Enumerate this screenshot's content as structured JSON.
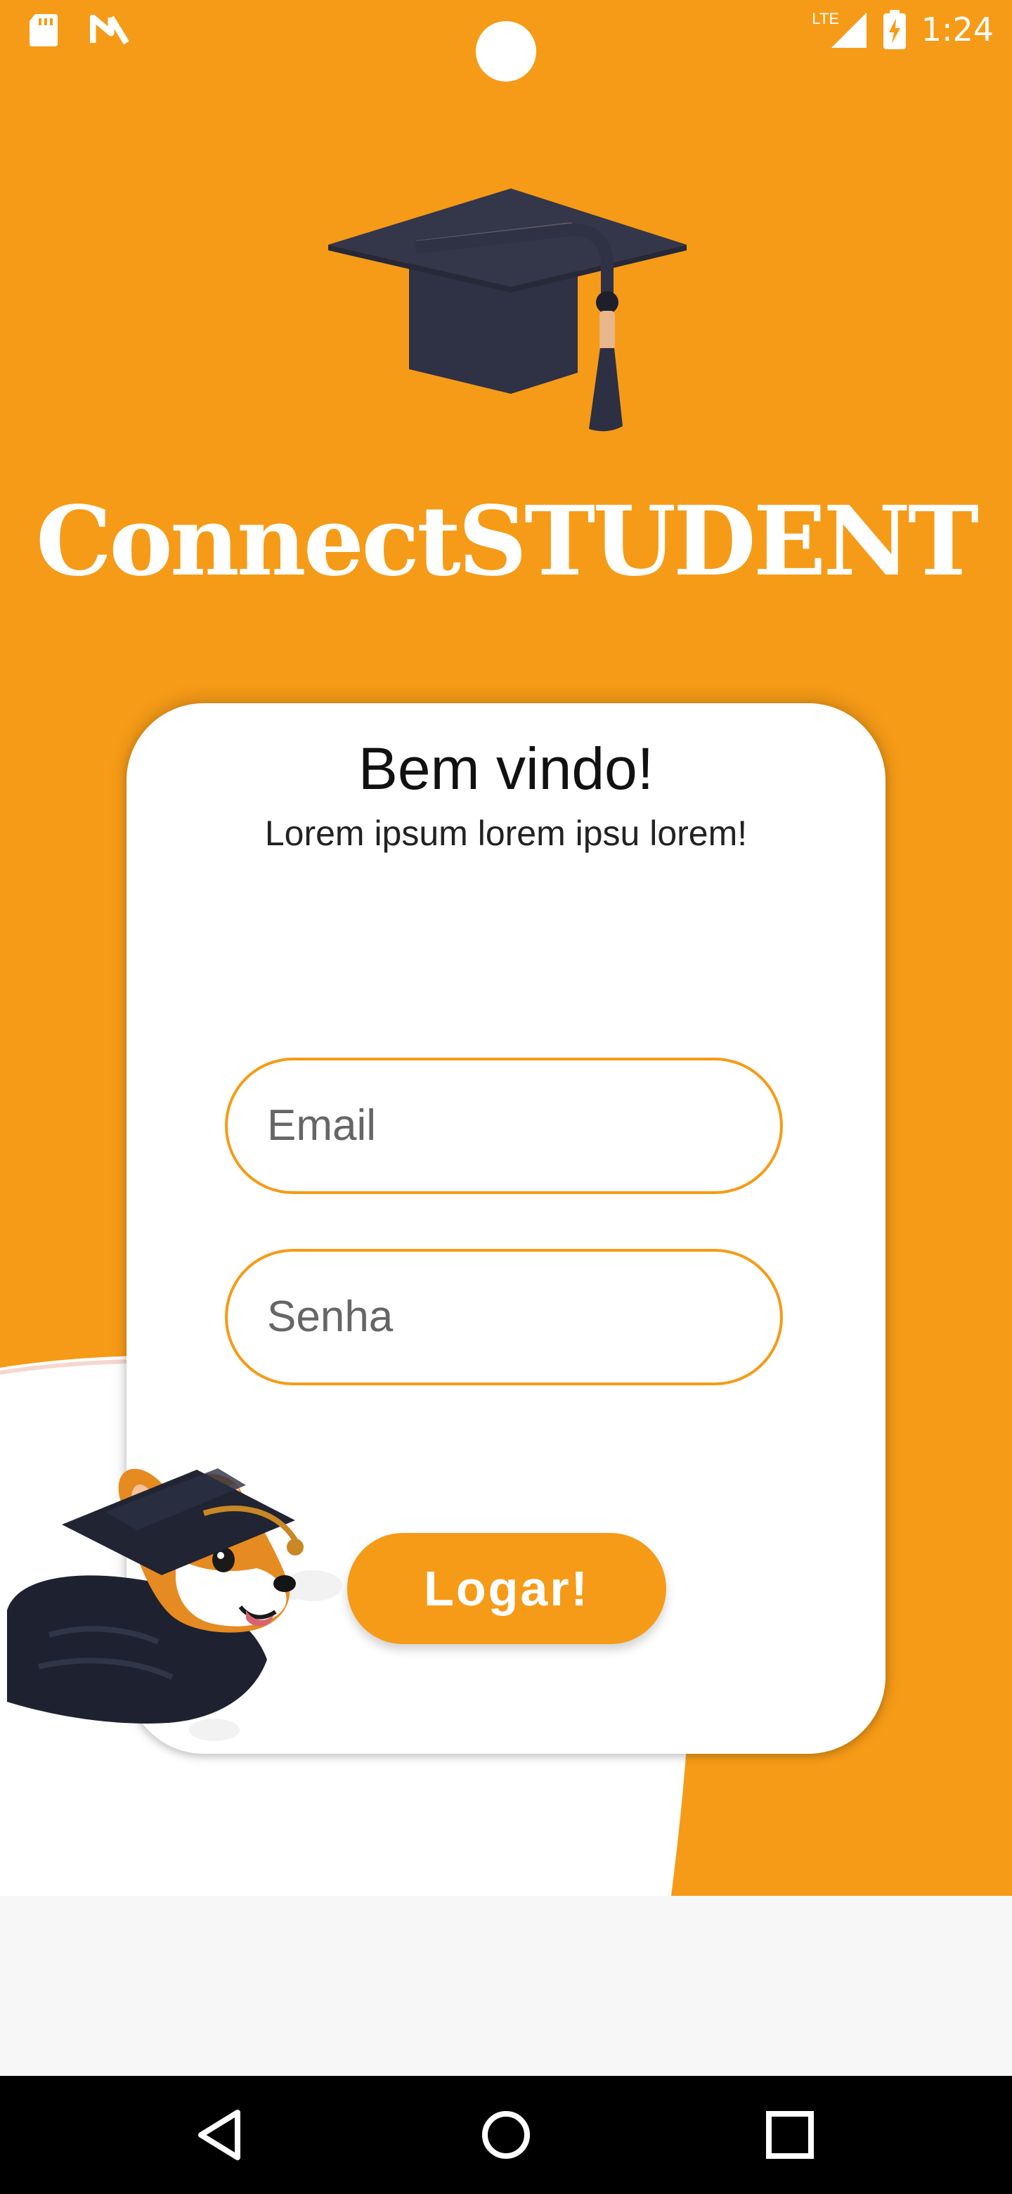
{
  "status_bar": {
    "time": "1:24",
    "network": "LTE",
    "icons": [
      "sd-card-icon",
      "n-notification-icon",
      "signal-icon",
      "battery-charging-icon"
    ]
  },
  "app": {
    "title": "ConnectSTUDENT",
    "logo_icon": "graduation-cap-icon"
  },
  "login_card": {
    "title": "Bem vindo!",
    "subtitle": "Lorem ipsum lorem ipsu lorem!",
    "email_placeholder": "Email",
    "password_placeholder": "Senha",
    "login_button": "Logar!",
    "mascot": "corgi-graduate-illustration"
  },
  "nav_bar": {
    "buttons": [
      "back-button",
      "home-button",
      "recents-button"
    ]
  },
  "colors": {
    "accent": "#F69B17",
    "card": "#FFFFFF",
    "nav_bar": "#000000"
  }
}
